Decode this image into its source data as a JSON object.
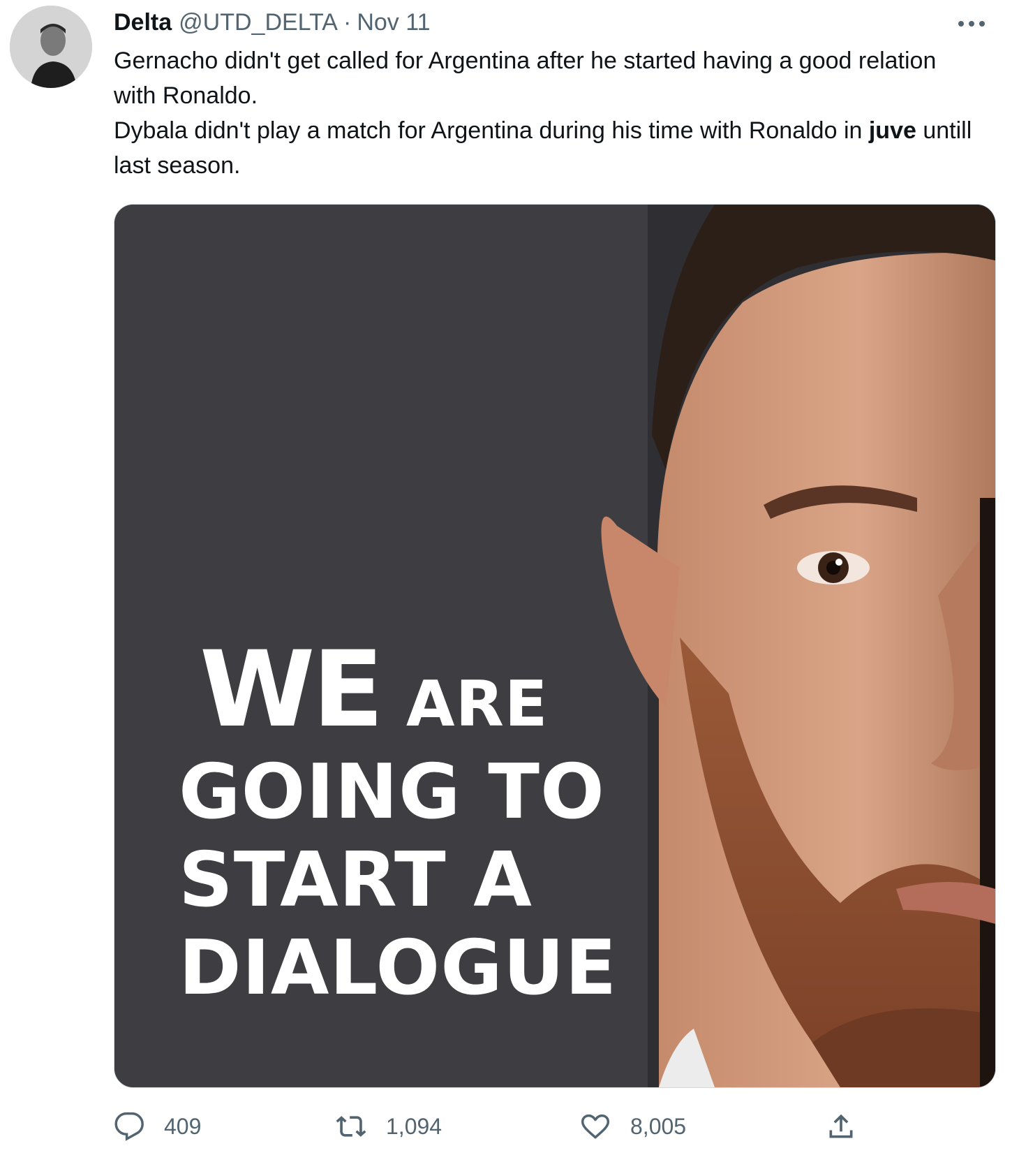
{
  "tweet": {
    "author_name": "Delta",
    "handle": "@UTD_DELTA",
    "separator": "·",
    "date": "Nov 11",
    "text_line1": "Gernacho didn't get called for Argentina after he started having a good relation with Ronaldo.",
    "text_line2_start": "Dybala didn't play a match for Argentina during his time with Ronaldo in ",
    "text_line2_bold": "juve",
    "text_line2_end": " untill last season."
  },
  "media": {
    "overlay_word1": "WE",
    "overlay_word2": "ARE",
    "overlay_line2": "GOING TO",
    "overlay_line3": "START A",
    "overlay_line4": "DIALOGUE"
  },
  "actions": {
    "reply_count": "409",
    "retweet_count": "1,094",
    "like_count": "8,005"
  },
  "icons": {
    "more": "more-horizontal-icon",
    "reply": "reply-bubble-icon",
    "retweet": "retweet-icon",
    "like": "heart-icon",
    "share": "share-upload-icon"
  },
  "colors": {
    "text_primary": "#0f1419",
    "text_secondary": "#536471",
    "media_background": "#3e3e42",
    "overlay_text": "#ffffff"
  }
}
